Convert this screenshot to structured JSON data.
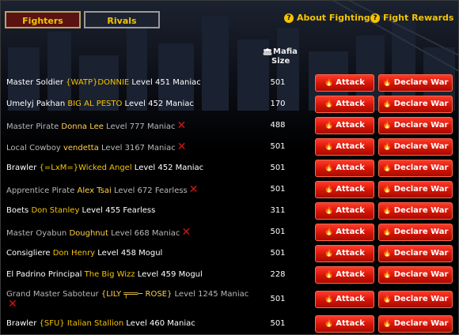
{
  "tabs": {
    "fighters": "Fighters",
    "rivals": "Rivals"
  },
  "links": {
    "about": "About Fighting",
    "rewards": "Fight Rewards"
  },
  "header": {
    "mafia_line1": "Mafia",
    "mafia_line2": "Size"
  },
  "buttons": {
    "attack": "Attack",
    "declare_war": "Declare War"
  },
  "icons": {
    "help": "question-icon",
    "mafia": "mafia-group-icon",
    "attack": "flame-icon",
    "remove": "red-x-icon"
  },
  "colors": {
    "accent": "#f5c400",
    "button": "#d41406",
    "remove": "#e01010"
  },
  "rows": [
    {
      "title": "Master Soldier",
      "player": "{WATP}DONNIE",
      "level": "Level 451 Maniac",
      "size": "501",
      "dim": false,
      "x": false
    },
    {
      "title": "Umelyj Pakhan",
      "player": "BIG AL PESTO",
      "level": "Level 452 Maniac",
      "size": "170",
      "dim": false,
      "x": false
    },
    {
      "title": "Master Pirate",
      "player": "Donna Lee",
      "level": "Level 777 Maniac",
      "size": "488",
      "dim": true,
      "x": true
    },
    {
      "title": "Local Cowboy",
      "player": "vendetta",
      "level": "Level 3167 Maniac",
      "size": "501",
      "dim": true,
      "x": true
    },
    {
      "title": "Brawler",
      "player": "{=LxM=}Wicked Angel",
      "level": "Level 452 Maniac",
      "size": "501",
      "dim": false,
      "x": false
    },
    {
      "title": "Apprentice Pirate",
      "player": "Alex Tsai",
      "level": "Level 672 Fearless",
      "size": "501",
      "dim": true,
      "x": true
    },
    {
      "title": "Boets",
      "player": "Don Stanley",
      "level": "Level 455 Fearless",
      "size": "311",
      "dim": false,
      "x": false
    },
    {
      "title": "Master Oyabun",
      "player": "Doughnut",
      "level": "Level 668 Maniac",
      "size": "501",
      "dim": true,
      "x": true
    },
    {
      "title": "Consigliere",
      "player": "Don Henry",
      "level": "Level 458 Mogul",
      "size": "501",
      "dim": false,
      "x": false
    },
    {
      "title": "El Padrino Principal",
      "player": "The Big Wizz",
      "level": "Level 459 Mogul",
      "size": "228",
      "dim": false,
      "x": false
    },
    {
      "title": "Grand Master Saboteur",
      "player": "{LILY ╤══─ ROSE}",
      "level": "Level 1245 Maniac",
      "size": "501",
      "dim": true,
      "x": true
    },
    {
      "title": "Brawler",
      "player": "{SFU} Italian Stallion",
      "level": "Level 460 Maniac",
      "size": "501",
      "dim": false,
      "x": false
    }
  ]
}
